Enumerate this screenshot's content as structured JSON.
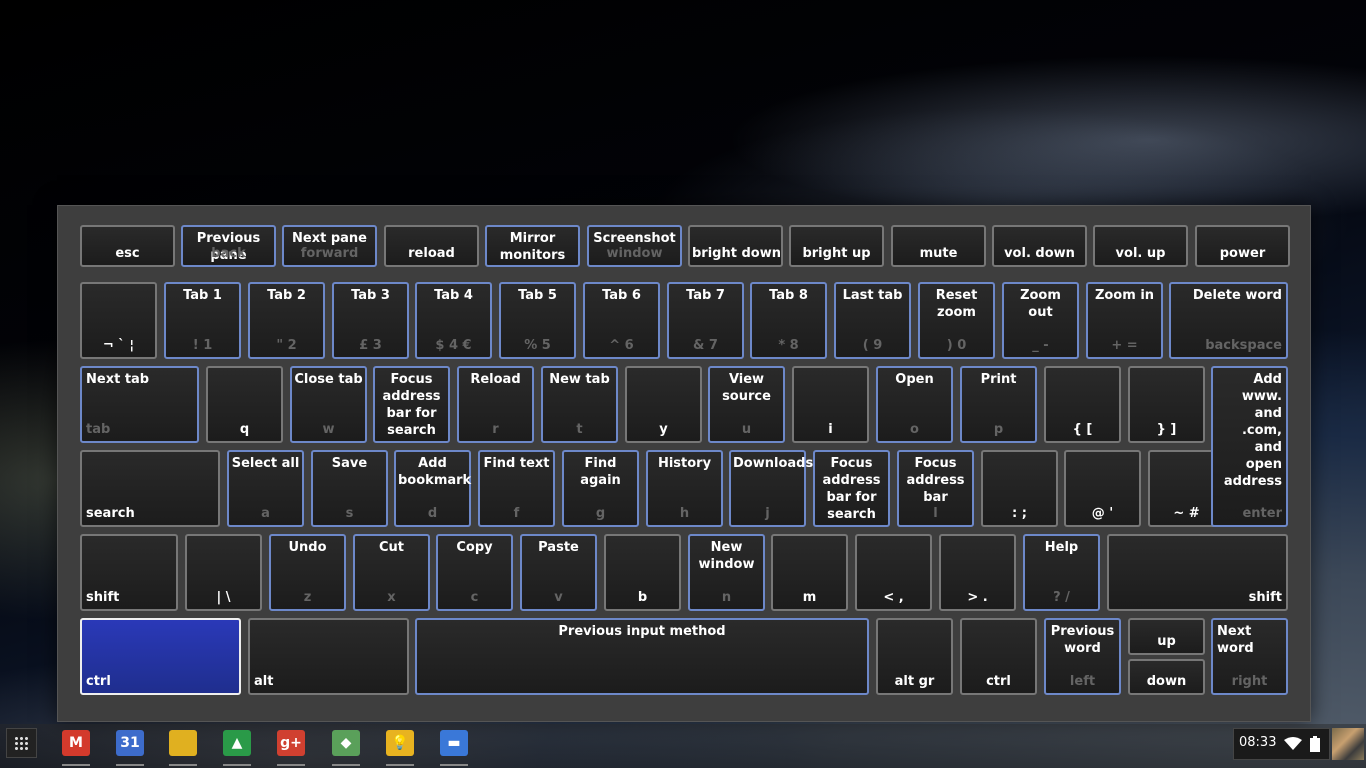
{
  "keyboard": {
    "row1": [
      {
        "label": "",
        "key": "esc",
        "active": false
      },
      {
        "label": "Previous pane",
        "key": "back",
        "active": true
      },
      {
        "label": "Next pane",
        "key": "forward",
        "active": true
      },
      {
        "label": "",
        "key": "reload",
        "active": false
      },
      {
        "label": "Mirror monitors",
        "key": "",
        "active": true
      },
      {
        "label": "Screenshot",
        "key": "window",
        "active": true
      },
      {
        "label": "",
        "key": "bright down",
        "active": false
      },
      {
        "label": "",
        "key": "bright up",
        "active": false
      },
      {
        "label": "",
        "key": "mute",
        "active": false
      },
      {
        "label": "",
        "key": "vol. down",
        "active": false
      },
      {
        "label": "",
        "key": "vol. up",
        "active": false
      },
      {
        "label": "",
        "key": "power",
        "active": false
      }
    ],
    "row2": [
      {
        "label": "",
        "key": "¬ ` ¦",
        "active": false
      },
      {
        "label": "Tab 1",
        "key": "! 1",
        "active": true
      },
      {
        "label": "Tab 2",
        "key": "\" 2",
        "active": true
      },
      {
        "label": "Tab 3",
        "key": "£ 3",
        "active": true
      },
      {
        "label": "Tab 4",
        "key": "$ 4 €",
        "active": true
      },
      {
        "label": "Tab 5",
        "key": "% 5",
        "active": true
      },
      {
        "label": "Tab 6",
        "key": "^ 6",
        "active": true
      },
      {
        "label": "Tab 7",
        "key": "& 7",
        "active": true
      },
      {
        "label": "Tab 8",
        "key": "* 8",
        "active": true
      },
      {
        "label": "Last tab",
        "key": "( 9",
        "active": true
      },
      {
        "label": "Reset zoom",
        "key": ") 0",
        "active": true
      },
      {
        "label": "Zoom out",
        "key": "_ -",
        "active": true
      },
      {
        "label": "Zoom in",
        "key": "+ =",
        "active": true
      },
      {
        "label": "Delete word",
        "key": "backspace",
        "active": true
      }
    ],
    "row3": [
      {
        "label": "Next tab",
        "key": "tab",
        "active": true
      },
      {
        "label": "",
        "key": "q",
        "active": false
      },
      {
        "label": "Close tab",
        "key": "w",
        "active": true
      },
      {
        "label": "Focus address bar for search",
        "key": "",
        "active": true
      },
      {
        "label": "Reload",
        "key": "r",
        "active": true
      },
      {
        "label": "New tab",
        "key": "t",
        "active": true
      },
      {
        "label": "",
        "key": "y",
        "active": false
      },
      {
        "label": "View source",
        "key": "u",
        "active": true
      },
      {
        "label": "",
        "key": "i",
        "active": false
      },
      {
        "label": "Open",
        "key": "o",
        "active": true
      },
      {
        "label": "Print",
        "key": "p",
        "active": true
      },
      {
        "label": "",
        "key": "{ [",
        "active": false
      },
      {
        "label": "",
        "key": "} ]",
        "active": false
      }
    ],
    "row4": [
      {
        "label": "",
        "key": "search",
        "active": false
      },
      {
        "label": "Select all",
        "key": "a",
        "active": true
      },
      {
        "label": "Save",
        "key": "s",
        "active": true
      },
      {
        "label": "Add bookmark",
        "key": "d",
        "active": true
      },
      {
        "label": "Find text",
        "key": "f",
        "active": true
      },
      {
        "label": "Find again",
        "key": "g",
        "active": true
      },
      {
        "label": "History",
        "key": "h",
        "active": true
      },
      {
        "label": "Downloads",
        "key": "j",
        "active": true
      },
      {
        "label": "Focus address bar for search",
        "key": "",
        "active": true
      },
      {
        "label": "Focus address bar",
        "key": "l",
        "active": true
      },
      {
        "label": "",
        "key": ": ;",
        "active": false
      },
      {
        "label": "",
        "key": "@ '",
        "active": false
      },
      {
        "label": "",
        "key": "~ #",
        "active": false
      }
    ],
    "enter": {
      "label": "Add www. and .com, and open address",
      "key": "enter",
      "active": true
    },
    "row5": [
      {
        "label": "",
        "key": "shift",
        "active": false
      },
      {
        "label": "",
        "key": "| \\",
        "active": false
      },
      {
        "label": "Undo",
        "key": "z",
        "active": true
      },
      {
        "label": "Cut",
        "key": "x",
        "active": true
      },
      {
        "label": "Copy",
        "key": "c",
        "active": true
      },
      {
        "label": "Paste",
        "key": "v",
        "active": true
      },
      {
        "label": "",
        "key": "b",
        "active": false
      },
      {
        "label": "New window",
        "key": "n",
        "active": true
      },
      {
        "label": "",
        "key": "m",
        "active": false
      },
      {
        "label": "",
        "key": "< ,",
        "active": false
      },
      {
        "label": "",
        "key": "> .",
        "active": false
      },
      {
        "label": "Help",
        "key": "? /",
        "active": true
      },
      {
        "label": "",
        "key": "shift",
        "active": false
      }
    ],
    "row6": [
      {
        "label": "",
        "key": "ctrl",
        "active": false,
        "selected": true
      },
      {
        "label": "",
        "key": "alt",
        "active": false
      },
      {
        "label": "Previous input method",
        "key": "",
        "active": true
      },
      {
        "label": "",
        "key": "alt gr",
        "active": false
      },
      {
        "label": "",
        "key": "ctrl",
        "active": false
      },
      {
        "label": "Previous word",
        "key": "left",
        "active": true
      },
      {
        "label": "",
        "key": "up",
        "active": false
      },
      {
        "label": "",
        "key": "down",
        "active": false
      },
      {
        "label": "Next word",
        "key": "right",
        "active": true
      }
    ]
  },
  "shelf": {
    "apps": [
      {
        "name": "gmail-icon",
        "glyph": "M",
        "color": "#d33a2c"
      },
      {
        "name": "calendar-icon",
        "glyph": "31",
        "color": "#3d6ccb"
      },
      {
        "name": "chrome-icon",
        "glyph": "",
        "color": "#e0b020"
      },
      {
        "name": "drive-icon",
        "glyph": "▲",
        "color": "#2a9a48"
      },
      {
        "name": "google-plus-icon",
        "glyph": "g+",
        "color": "#d04030"
      },
      {
        "name": "maps-icon",
        "glyph": "◆",
        "color": "#5aa05a"
      },
      {
        "name": "keep-icon",
        "glyph": "💡",
        "color": "#e8b320"
      },
      {
        "name": "files-icon",
        "glyph": "▬",
        "color": "#3a78d8"
      }
    ],
    "time": "08:33"
  }
}
